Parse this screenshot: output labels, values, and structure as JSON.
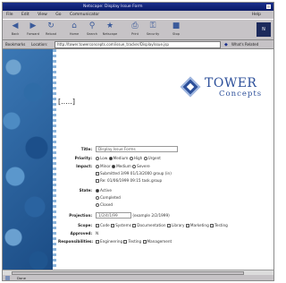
{
  "window": {
    "title": "Netscape: Display Issue Form"
  },
  "menubar": {
    "items": [
      "File",
      "Edit",
      "View",
      "Go",
      "Communicator"
    ],
    "help": "Help"
  },
  "toolbar": {
    "buttons": [
      {
        "label": "Back",
        "icon": "back-arrow-icon"
      },
      {
        "label": "Forward",
        "icon": "forward-arrow-icon"
      },
      {
        "label": "Reload",
        "icon": "reload-icon"
      },
      {
        "label": "Home",
        "icon": "home-icon"
      },
      {
        "label": "Search",
        "icon": "search-icon"
      },
      {
        "label": "Netscape",
        "icon": "netscape-icon"
      },
      {
        "label": "Print",
        "icon": "print-icon"
      },
      {
        "label": "Security",
        "icon": "security-icon"
      },
      {
        "label": "Stop",
        "icon": "stop-icon"
      }
    ],
    "brand": "N"
  },
  "addressbar": {
    "bookmarks_label": "Bookmarks",
    "location_label": "Location:",
    "url": "http://tower.towerconcepts.com/issue_tracker/DisplayIssue.jsp",
    "related_label": "What's Related"
  },
  "logo": {
    "line1": "TOWER",
    "line2": "Concepts"
  },
  "page": {
    "heading": "[.....]"
  },
  "form": {
    "title_label": "Title:",
    "title_value": "Display Issue Forms",
    "priority_label": "Priority:",
    "priority_options": [
      "Low",
      "Medium",
      "High",
      "Urgent"
    ],
    "impact_label": "Impact:",
    "impact_options": [
      "Minor",
      "Medium",
      "Severe"
    ],
    "impact_line2": "Submitted 3/99 01/13/2000 group (in)",
    "impact_line3": "Re: 01/06/1999 09:15 task.group",
    "state_label": "State:",
    "state_options": [
      "Active",
      "Completed",
      "Closed"
    ],
    "projection_label": "Projection:",
    "projection_value": "1/2/4/1/99",
    "projection_hint": "(example 2/2/1999)",
    "scope_label": "Scope:",
    "scope_options": [
      "Code",
      "Systems",
      "Documentation",
      "Library",
      "Marketing",
      "Testing"
    ],
    "approved_label": "Approved:",
    "approved_value": "N",
    "responsibilities_label": "Responsibilities:",
    "responsibilities_options": [
      "Engineering",
      "Testing",
      "Management"
    ]
  },
  "statusbar": {
    "text": "Done",
    "right": ""
  },
  "colors": {
    "brand_blue": "#2c4f9a",
    "title_bar": "#1a2f8c",
    "chrome": "#c6c3c6"
  }
}
